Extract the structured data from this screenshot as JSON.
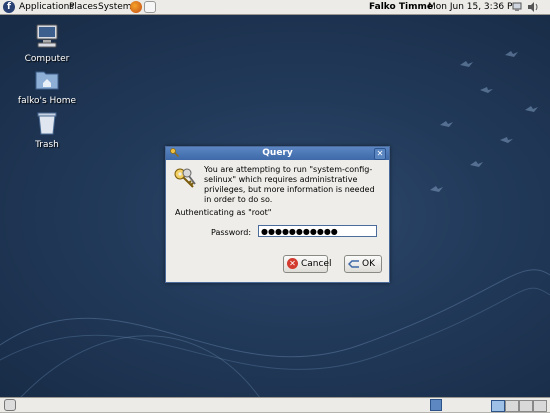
{
  "top_panel": {
    "menus": [
      "Applications",
      "Places",
      "System"
    ],
    "user_name": "Falko Timme",
    "clock": "Mon Jun 15,  3:36 PM"
  },
  "desktop": {
    "icons": [
      {
        "label": "Computer",
        "icon": "computer-icon"
      },
      {
        "label": "falko's Home",
        "icon": "home-folder-icon"
      },
      {
        "label": "Trash",
        "icon": "trash-icon"
      }
    ]
  },
  "dialog": {
    "title": "Query",
    "message": "You are attempting to run \"system-config-selinux\" which requires administrative privileges, but more information is needed in order to do so.",
    "auth_label": "Authenticating as \"root\"",
    "password_label": "Password:",
    "password_value": "●●●●●●●●●●●",
    "cancel_label": "Cancel",
    "ok_label": "OK"
  },
  "colors": {
    "desktop_bg": "#1f3552",
    "panel_bg": "#ecebe8",
    "titlebar": "#4a77b4"
  }
}
